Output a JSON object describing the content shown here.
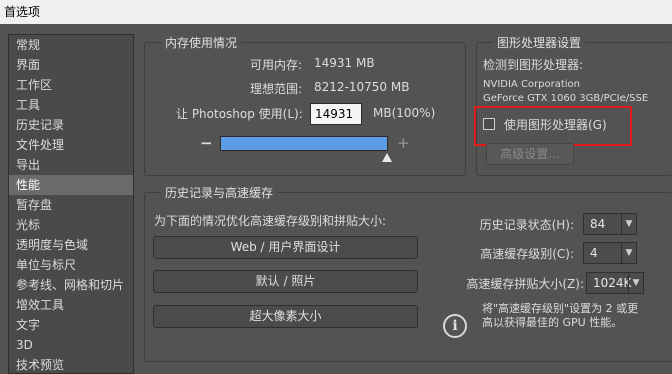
{
  "window": {
    "title": "首选项"
  },
  "sidebar": {
    "items": [
      {
        "label": "常规"
      },
      {
        "label": "界面"
      },
      {
        "label": "工作区"
      },
      {
        "label": "工具"
      },
      {
        "label": "历史记录"
      },
      {
        "label": "文件处理"
      },
      {
        "label": "导出"
      },
      {
        "label": "性能",
        "active": true
      },
      {
        "label": "暂存盘"
      },
      {
        "label": "光标"
      },
      {
        "label": "透明度与色域"
      },
      {
        "label": "单位与标尺"
      },
      {
        "label": "参考线、网格和切片"
      },
      {
        "label": "增效工具"
      },
      {
        "label": "文字"
      },
      {
        "label": "3D"
      },
      {
        "label": "技术预览"
      }
    ]
  },
  "memory": {
    "title": "内存使用情况",
    "available_label": "可用内存:",
    "available_value": "14931 MB",
    "ideal_label": "理想范围:",
    "ideal_value": "8212-10750 MB",
    "let_label": "让 Photoshop 使用(L):",
    "let_value": "14931",
    "let_unit": "MB(100%)",
    "minus": "−",
    "plus": "+",
    "usage_fraction": 1.0
  },
  "gpu": {
    "title": "图形处理器设置",
    "detected_label": "检测到图形处理器:",
    "vendor": "NVIDIA Corporation",
    "model": "GeForce GTX 1060 3GB/PCIe/SSE",
    "use_gpu_label": "使用图形处理器(G)",
    "use_gpu_checked": false,
    "advanced_button": "高级设置..."
  },
  "history_cache": {
    "title": "历史记录与高速缓存",
    "optimize_label": "为下面的情况优化高速缓存级别和拼贴大小:",
    "buttons": [
      "Web / 用户界面设计",
      "默认 / 照片",
      "超大像素大小"
    ],
    "history_states_label": "历史记录状态(H):",
    "history_states_value": "84",
    "cache_levels_label": "高速缓存级别(C):",
    "cache_levels_value": "4",
    "tile_size_label": "高速缓存拼贴大小(Z):",
    "tile_size_value": "1024K",
    "info_line1": "将\"高速缓存级别\"设置为 2 或更",
    "info_line2": "高以获得最佳的 GPU 性能。",
    "info_icon": "i"
  },
  "colors": {
    "background": "#535353",
    "accent_bar": "#5c9ce6",
    "highlight": "#e21b1b"
  }
}
